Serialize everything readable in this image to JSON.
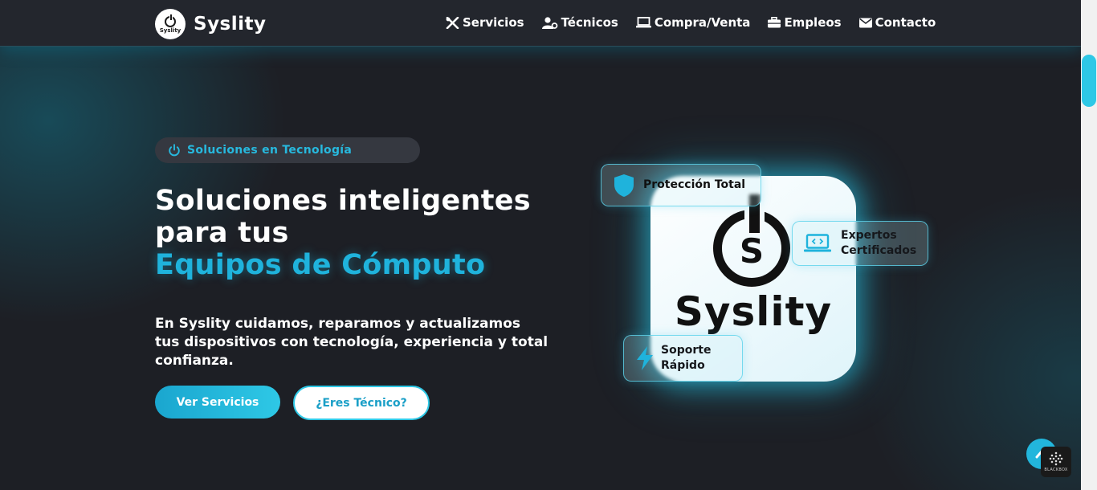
{
  "navbar": {
    "brand_name": "Syslity",
    "brand_logo_text": "Syslity",
    "items": [
      {
        "label": "Servicios",
        "icon": "tools-icon"
      },
      {
        "label": "Técnicos",
        "icon": "user-gear-icon"
      },
      {
        "label": "Compra/Venta",
        "icon": "laptop-icon"
      },
      {
        "label": "Empleos",
        "icon": "briefcase-icon"
      },
      {
        "label": "Contacto",
        "icon": "envelope-icon"
      }
    ]
  },
  "hero": {
    "badge_label": "Soluciones en Tecnología",
    "title_line1": "Soluciones inteligentes",
    "title_line2": "para tus",
    "title_accent": "Equipos de Cómputo",
    "description": "En Syslity cuidamos, reparamos y actualizamos tus dispositivos con tecnología, experiencia y total confianza.",
    "primary_button": "Ver Servicios",
    "secondary_button": "¿Eres Técnico?"
  },
  "showcase": {
    "logo_letter": "S",
    "logo_name": "Syslity",
    "tags": {
      "protection": "Protección Total",
      "experts_line1": "Expertos",
      "experts_line2": "Certificados",
      "support_line1": "Soporte",
      "support_line2": "Rápido"
    }
  },
  "widgets": {
    "corner_label": "BLACKBOX"
  },
  "colors": {
    "accent": "#1fb3dc",
    "background": "#1d1f25",
    "navbar": "#23262d",
    "badge_bg": "#353840"
  }
}
